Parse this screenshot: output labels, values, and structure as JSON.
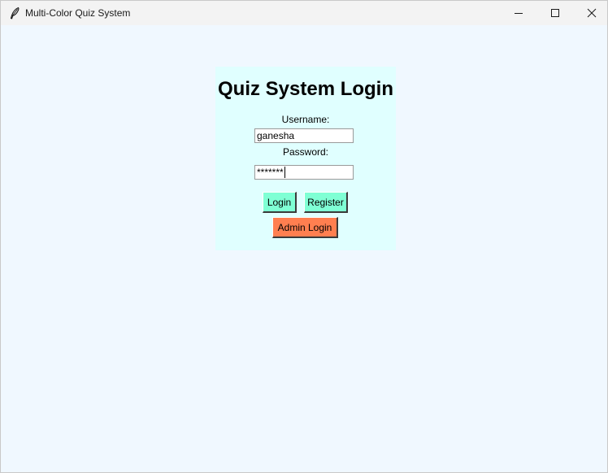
{
  "window": {
    "title": "Multi-Color Quiz System",
    "controls": {
      "minimize_icon": "minimize-icon",
      "maximize_icon": "maximize-icon",
      "close_icon": "close-icon"
    }
  },
  "login": {
    "heading": "Quiz System Login",
    "username_label": "Username:",
    "username_value": "ganesha",
    "password_label": "Password:",
    "password_value": "*******",
    "login_button": "Login",
    "register_button": "Register",
    "admin_login_button": "Admin Login"
  },
  "colors": {
    "window_background": "#f0f8ff",
    "panel_background": "#e0ffff",
    "primary_button": "#7fffd4",
    "admin_button": "#ff7f50"
  }
}
